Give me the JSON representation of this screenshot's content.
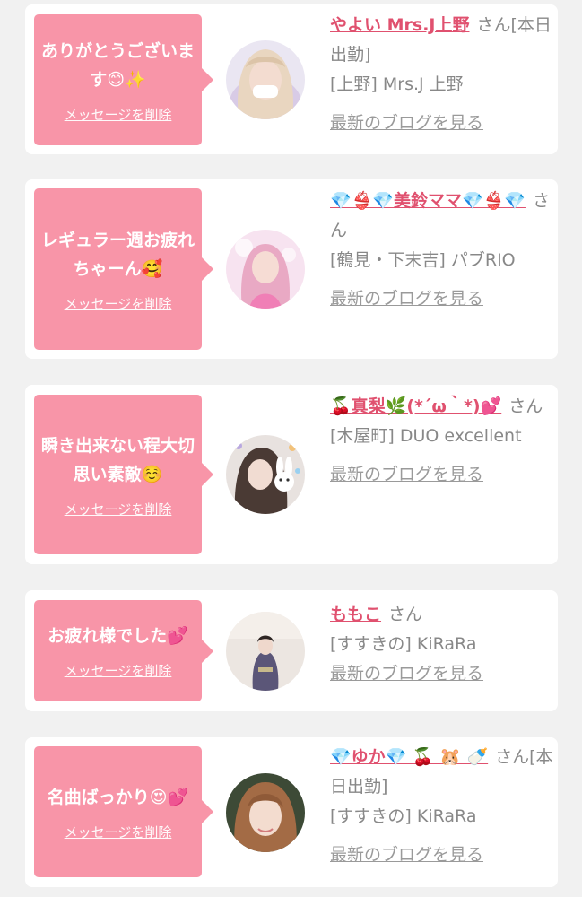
{
  "cards": [
    {
      "message": "ありがとうございます😊✨",
      "delete_label": "メッセージを削除",
      "name": "やよい Mrs.J上野",
      "san": "さん[本日出勤]",
      "shop": "[上野] Mrs.J 上野",
      "blog_label": "最新のブログを見る",
      "avatar_icon": "profile-photo-blonde-mask"
    },
    {
      "message": "レギュラー週お疲れちゃーん🥰",
      "delete_label": "メッセージを削除",
      "name": "💎👙💎美鈴ママ💎👙💎",
      "san": "さん",
      "shop": "[鶴見・下末吉] パブRIO",
      "blog_label": "最新のブログを見る",
      "avatar_icon": "profile-photo-pink"
    },
    {
      "message": "瞬き出来ない程大切思い素敵☺️",
      "delete_label": "メッセージを削除",
      "name": "🍒真梨🌿(*´ω｀*)💕",
      "san": "さん",
      "shop": "[木屋町] DUO excellent",
      "blog_label": "最新のブログを見る",
      "avatar_icon": "profile-photo-bunny-sticker"
    },
    {
      "message": "お疲れ様でした💕",
      "delete_label": "メッセージを削除",
      "name": "ももこ",
      "san": "さん",
      "shop": "[すすきの] KiRaRa",
      "blog_label": "最新のブログを見る",
      "avatar_icon": "profile-photo-kimono"
    },
    {
      "message": "名曲ばっかり😍💕",
      "delete_label": "メッセージを削除",
      "name": "💎ゆか💎 🍒 🐹 🍼",
      "san": "さん[本日出勤]",
      "shop": "[すすきの] KiRaRa",
      "blog_label": "最新のブログを見る",
      "avatar_icon": "profile-photo-brown-hair"
    }
  ],
  "colors": {
    "bubble": "#f895a8",
    "name": "#e0516f",
    "background": "#f1f1f1"
  }
}
